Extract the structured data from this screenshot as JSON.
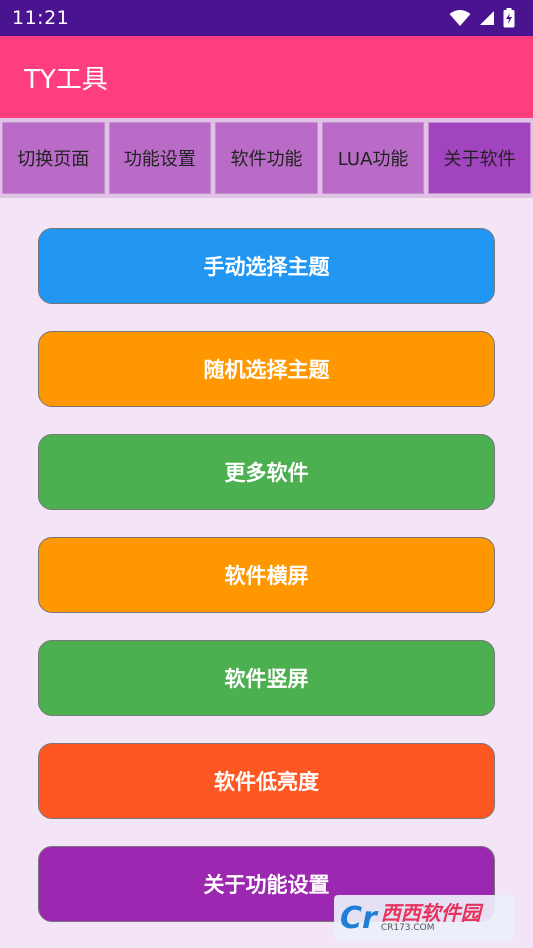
{
  "status": {
    "time": "11:21"
  },
  "app": {
    "title": "TY工具",
    "title_bar_color": "#ff3f7d"
  },
  "tabs": [
    {
      "label": "切换页面"
    },
    {
      "label": "功能设置"
    },
    {
      "label": "软件功能"
    },
    {
      "label": "LUA功能"
    },
    {
      "label": "关于软件",
      "active": true
    }
  ],
  "buttons": [
    {
      "label": "手动选择主题",
      "color": "#2196f3"
    },
    {
      "label": "随机选择主题",
      "color": "#ff9800"
    },
    {
      "label": "更多软件",
      "color": "#4caf50"
    },
    {
      "label": "软件横屏",
      "color": "#ff9800"
    },
    {
      "label": "软件竖屏",
      "color": "#4caf50"
    },
    {
      "label": "软件低亮度",
      "color": "#ff5722"
    },
    {
      "label": "关于功能设置",
      "color": "#9c27b0"
    }
  ],
  "watermark": {
    "logo": "Cr",
    "main": "西西软件园",
    "sub": "CR173.COM"
  }
}
